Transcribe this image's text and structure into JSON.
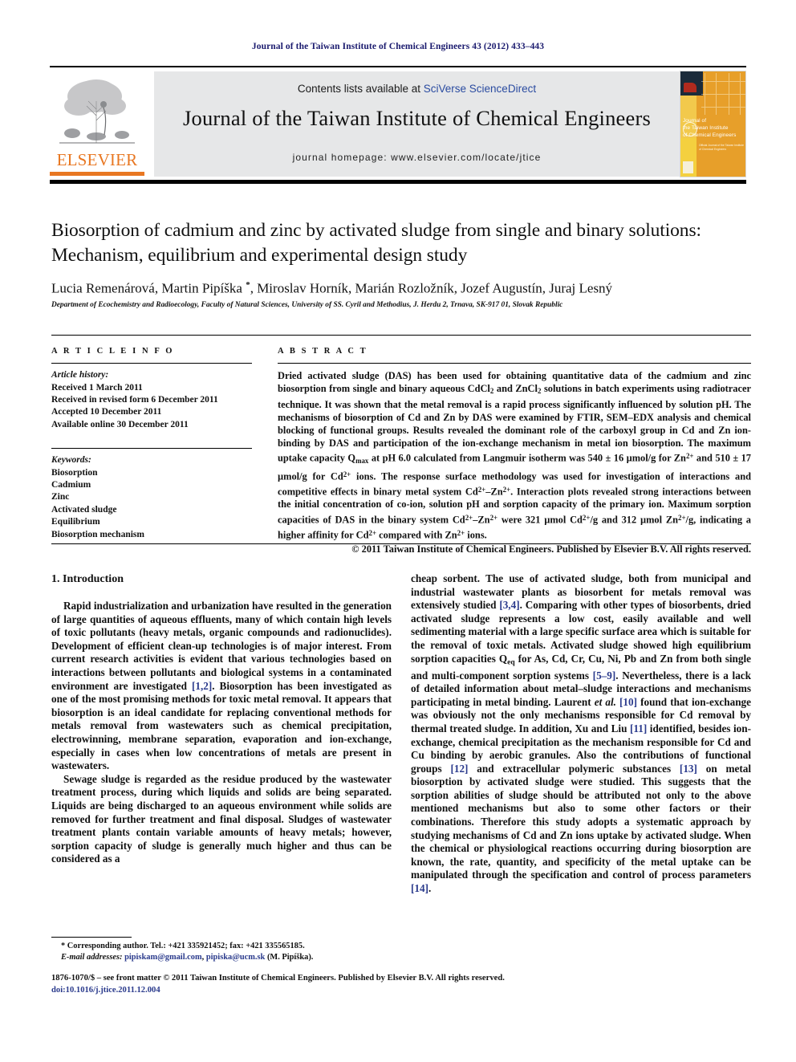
{
  "running_head": "Journal of the Taiwan Institute of Chemical Engineers 43 (2012) 433–443",
  "masthead": {
    "contents_prefix": "Contents lists available at ",
    "contents_link": "SciVerse ScienceDirect",
    "journal_title": "Journal of the Taiwan Institute of Chemical Engineers",
    "homepage": "journal homepage: www.elsevier.com/locate/jtice",
    "publisher_logo_text": "ELSEVIER",
    "cover": {
      "line1": "Journal of",
      "line2": "the Taiwan Institute",
      "line3": "of Chemical Engineers",
      "sub": "Official Journal of the Taiwan Institute of Chemical Engineers"
    }
  },
  "article": {
    "title": "Biosorption of cadmium and zinc by activated sludge from single and binary solutions: Mechanism, equilibrium and experimental design study",
    "authors": "Lucia Remenárová, Martin Pipíška *, Miroslav Horník, Marián Rozložník, Jozef Augustín, Juraj Lesný",
    "affiliation": "Department of Ecochemistry and Radioecology, Faculty of Natural Sciences, University of SS. Cyril and Methodius, J. Herdu 2, Trnava, SK-917 01, Slovak Republic"
  },
  "article_info": {
    "heading": "A R T I C L E   I N F O",
    "history_label": "Article history:",
    "history": [
      "Received 1 March 2011",
      "Received in revised form 6 December 2011",
      "Accepted 10 December 2011",
      "Available online 30 December 2011"
    ],
    "keywords_label": "Keywords:",
    "keywords": [
      "Biosorption",
      "Cadmium",
      "Zinc",
      "Activated sludge",
      "Equilibrium",
      "Biosorption mechanism"
    ]
  },
  "abstract": {
    "heading": "A B S T R A C T",
    "copyright": "© 2011 Taiwan Institute of Chemical Engineers. Published by Elsevier B.V. All rights reserved."
  },
  "introduction": {
    "heading": "1. Introduction"
  },
  "footnote": {
    "corresponding": "* Corresponding author. Tel.: +421 335921452; fax: +421 335565185.",
    "email_label": "E-mail addresses:",
    "email1": "pipiskam@gmail.com",
    "email2": "pipiska@ucm.sk",
    "email_owner": "(M. Pipíška)."
  },
  "imprint": {
    "line": "1876-1070/$ – see front matter © 2011 Taiwan Institute of Chemical Engineers. Published by Elsevier B.V. All rights reserved.",
    "doi": "doi:10.1016/j.jtice.2011.12.004"
  },
  "colors": {
    "link": "#2a4ba0",
    "elsevier_orange": "#E87722",
    "reference": "#2a3a8c",
    "running_head": "#1a1a6e"
  }
}
